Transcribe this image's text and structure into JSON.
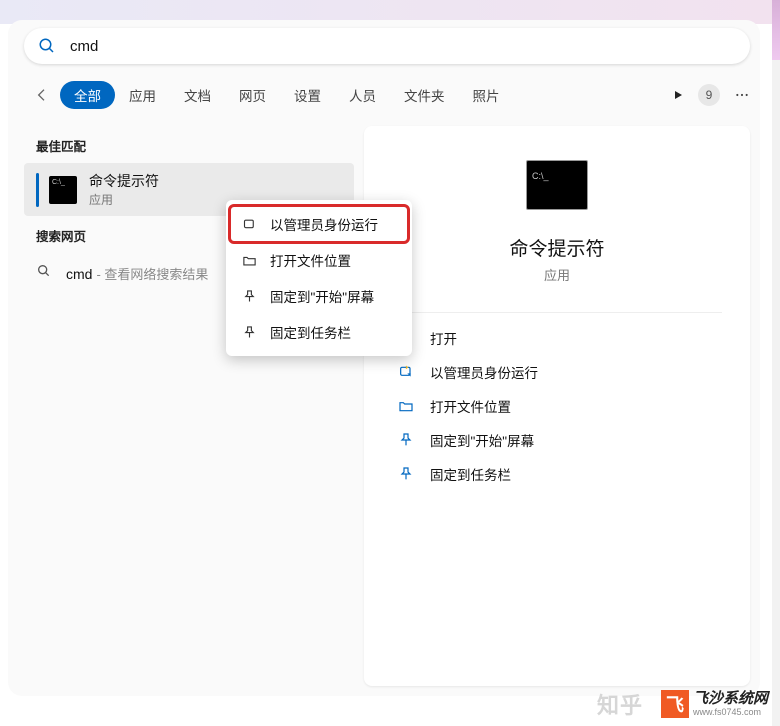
{
  "search": {
    "query": "cmd"
  },
  "tabs": {
    "items": [
      {
        "label": "全部",
        "active": true
      },
      {
        "label": "应用",
        "active": false
      },
      {
        "label": "文档",
        "active": false
      },
      {
        "label": "网页",
        "active": false
      },
      {
        "label": "设置",
        "active": false
      },
      {
        "label": "人员",
        "active": false
      },
      {
        "label": "文件夹",
        "active": false
      },
      {
        "label": "照片",
        "active": false
      }
    ],
    "badge": "9"
  },
  "groups": {
    "best_match": "最佳匹配",
    "web": "搜索网页"
  },
  "result": {
    "title": "命令提示符",
    "subtitle": "应用"
  },
  "web_result": {
    "query": "cmd",
    "suffix": " - 查看网络搜索结果"
  },
  "detail": {
    "title": "命令提示符",
    "subtitle": "应用",
    "actions": [
      {
        "icon": "open",
        "label": "打开"
      },
      {
        "icon": "admin",
        "label": "以管理员身份运行"
      },
      {
        "icon": "folder",
        "label": "打开文件位置"
      },
      {
        "icon": "pin-start",
        "label": "固定到\"开始\"屏幕"
      },
      {
        "icon": "pin-task",
        "label": "固定到任务栏"
      }
    ]
  },
  "context_menu": {
    "items": [
      {
        "icon": "admin",
        "label": "以管理员身份运行",
        "highlight": true
      },
      {
        "icon": "folder",
        "label": "打开文件位置",
        "highlight": false
      },
      {
        "icon": "pin-start",
        "label": "固定到\"开始\"屏幕",
        "highlight": false
      },
      {
        "icon": "pin-task",
        "label": "固定到任务栏",
        "highlight": false
      }
    ]
  },
  "watermark": {
    "zhihu": "知乎",
    "fs_name": "飞沙系统网",
    "fs_url": "www.fs0745.com",
    "fs_initials": "飞"
  }
}
